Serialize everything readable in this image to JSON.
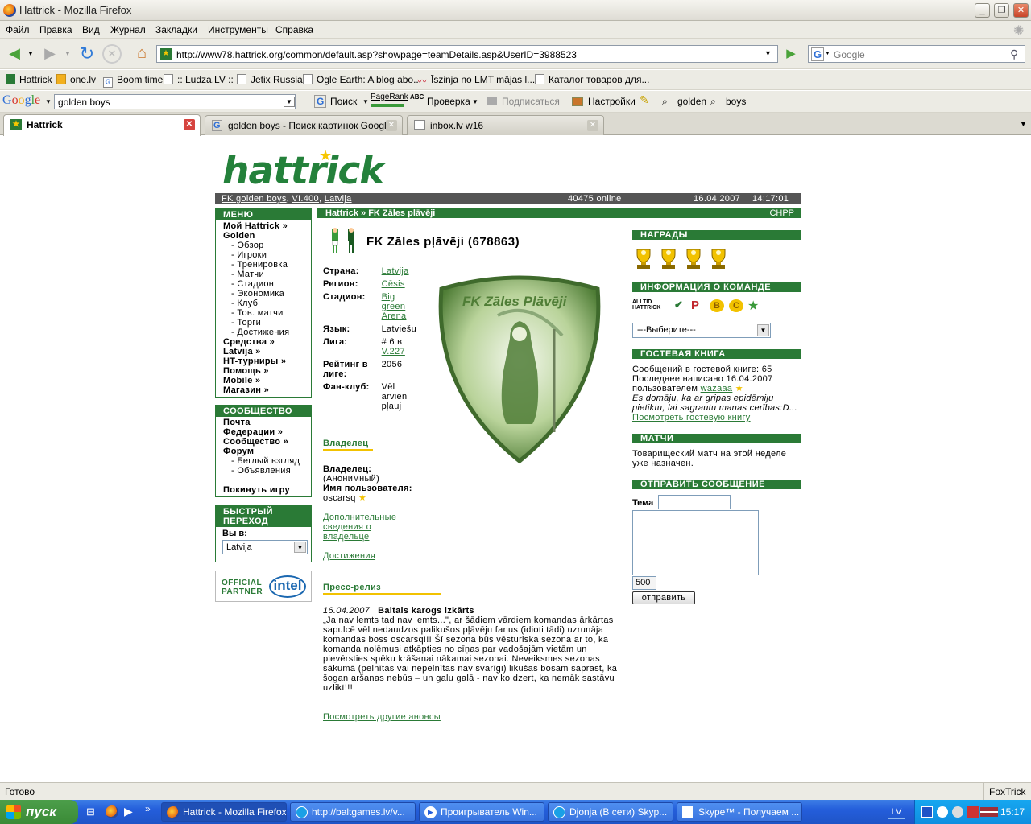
{
  "window": {
    "title": "Hattrick - Mozilla Firefox"
  },
  "menubar": [
    "Файл",
    "Правка",
    "Вид",
    "Журнал",
    "Закладки",
    "Инструменты",
    "Справка"
  ],
  "nav": {
    "url": "http://www78.hattrick.org/common/default.asp?showpage=teamDetails.asp&UserID=3988523",
    "search_placeholder": "Google"
  },
  "bookmarks": [
    "Hattrick",
    "one.lv",
    "Boom time",
    ":: Ludza.LV ::",
    "Jetix Russia",
    "Ogle Earth: A blog abo...",
    "Īszinja no LMT mājas l...",
    "Каталог товаров для..."
  ],
  "gtoolbar": {
    "logo": "Google",
    "query": "golden boys",
    "search": "Поиск",
    "pagerank": "PageRank",
    "check": "Проверка",
    "subscribe": "Подписаться",
    "settings": "Настройки",
    "word1": "golden",
    "word2": "boys"
  },
  "tabs": [
    {
      "label": "Hattrick"
    },
    {
      "label": "golden boys - Поиск картинок Google"
    },
    {
      "label": "inbox.lv w16"
    }
  ],
  "hattrick": {
    "logo": "hattrick",
    "topbar": {
      "team": "FK golden boys",
      "league": "VI.400",
      "country": "Latvija",
      "online": "40475 online",
      "date": "16.04.2007",
      "time": "14:17:01"
    },
    "menu": {
      "title": "МЕНЮ",
      "my": "Мой Hattrick »",
      "golden": "Golden",
      "sub": [
        "Обзор",
        "Игроки",
        "Тренировка",
        "Матчи",
        "Стадион",
        "Экономика",
        "Клуб",
        "Тов. матчи",
        "Торги",
        "Достижения"
      ],
      "after": [
        "Средства »",
        "Latvija »",
        "HT-турниры »",
        "Помощь »",
        "Mobile »",
        "Магазин »"
      ]
    },
    "community": {
      "title": "СООБЩЕСТВО",
      "items": [
        "Почта",
        "Федерации »",
        "Сообщество »",
        "Форум"
      ],
      "sub": [
        "Беглый взгляд",
        "Объявления"
      ],
      "quit": "Покинуть игру"
    },
    "quick": {
      "title": "БЫСТРЫЙ ПЕРЕХОД",
      "label": "Вы в:",
      "value": "Latvija"
    },
    "partner": {
      "line1": "OFFICIAL",
      "line2": "PARTNER",
      "brand": "intel"
    },
    "breadcrumb": {
      "path": "Hattrick » FK Zāles plāvēji",
      "right": "CHPP"
    },
    "team": {
      "name": "FK Zāles pļāvēji (678863)",
      "badge_text": "FK Zāles Plāvēji",
      "rows": [
        [
          "Страна:",
          "Latvija",
          true
        ],
        [
          "Регион:",
          "Cēsis",
          true
        ],
        [
          "Стадион:",
          "Big green Arena",
          true
        ],
        [
          "Язык:",
          "Latviešu",
          false
        ],
        [
          "Лига:",
          "# 6 в",
          false
        ],
        [
          "Рейтинг в лиге:",
          "2056",
          false
        ],
        [
          "Фан-клуб:",
          "Vēl arvien pļauj",
          false
        ]
      ],
      "league_link": "V.227"
    },
    "owner": {
      "heading": "Владелец",
      "l1": "Владелец:",
      "v1": "(Анонимный)",
      "l2": "Имя пользователя:",
      "v2": "oscarsq",
      "more": "Дополнительные сведения о владельце",
      "ach": "Достижения"
    },
    "press": {
      "heading": "Пресс-релиз",
      "date": "16.04.2007",
      "title": "Baltais karogs izkārts",
      "body": "„Ja nav lemts tad nav lemts...\", ar šādiem vārdiem komandas ārkārtas sapulcē vēl nedaudzos palikušos pļāvēju fanus (idioti tādi) uzrunāja komandas boss oscarsq!!! Šī sezona būs vēsturiska sezona ar to, ka komanda nolēmusi atkāpties no cīņas par vadošajām vietām un pievērsties spēku krāšanai nākamai sezonai. Neveiksmes sezonas sākumā (pelnītas vai nepelnītas nav svarīgi) likušas bosam saprast, ka šogan aršanas nebūs – un galu galā - nav ko dzert, ka nemāk sastāvu uzlikt!!!",
      "more": "Посмотреть другие анонсы"
    },
    "awards": {
      "title": "НАГРАДЫ",
      "count": 4
    },
    "info": {
      "title": "ИНФОРМАЦИЯ О КОМАНДЕ",
      "select": "---Выберите---",
      "alltid": "ALLTID HATTRICK"
    },
    "guestbook": {
      "title": "ГОСТЕВАЯ КНИГА",
      "count": "Сообщений в гостевой книге: 65",
      "last": "Последнее написано 16.04.2007",
      "by": "пользователем",
      "user": "wazaaa",
      "quote": "Es domāju, ka ar gripas epidēmiju pietiktu, lai sagrautu manas cerības:D...",
      "link": "Посмотреть гостевую книгу"
    },
    "matches": {
      "title": "МАТЧИ",
      "text": "Товарищеский матч на этой неделе уже назначен."
    },
    "message": {
      "title": "ОТПРАВИТЬ СООБЩЕНИЕ",
      "subject": "Тема",
      "counter": "500",
      "send": "отправить"
    }
  },
  "status": {
    "left": "Готово",
    "right": "FoxTrick"
  },
  "taskbar": {
    "start": "пуск",
    "tasks": [
      "Hattrick - Mozilla Firefox",
      "http://baltgames.lv/v...",
      "Проигрыватель Win...",
      "Djonja (В сети) Skyp...",
      "Skype™ - Получаем ..."
    ],
    "lang": "LV",
    "clock": "15:17"
  }
}
